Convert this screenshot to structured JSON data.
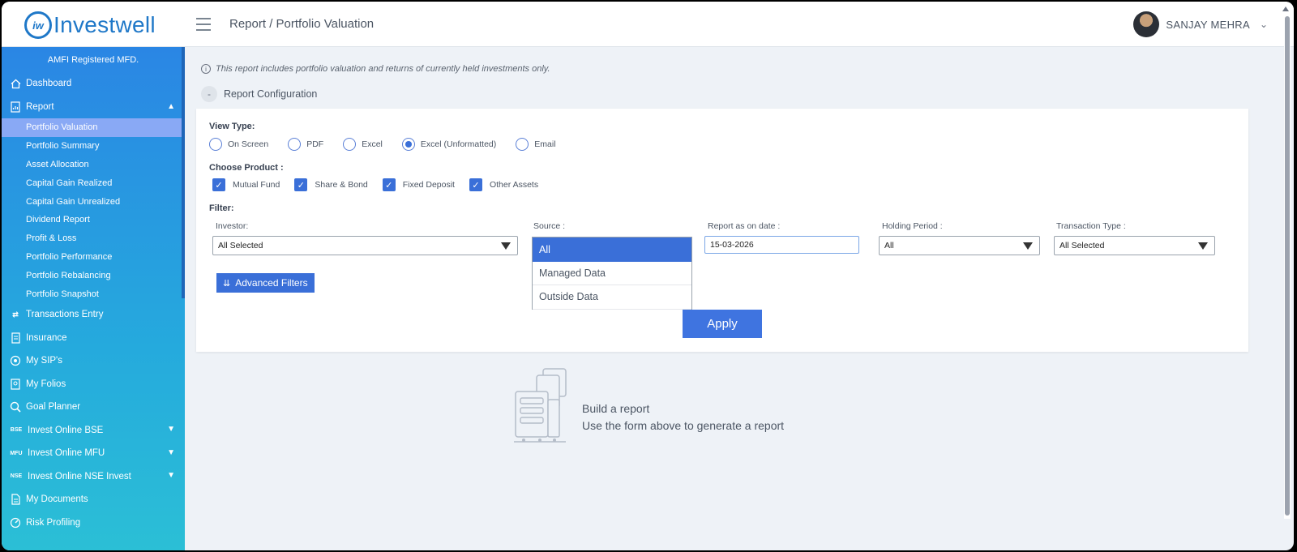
{
  "header": {
    "logo_text": "Investwell",
    "logo_mark": "iw",
    "breadcrumb": "Report / Portfolio Valuation",
    "user_name": "SANJAY MEHRA"
  },
  "sidebar": {
    "amfi": "AMFI Registered MFD.",
    "items": [
      {
        "label": "Dashboard",
        "icon": "home-icon"
      },
      {
        "label": "Report",
        "icon": "report-icon",
        "expanded": true
      },
      {
        "label": "Transactions Entry",
        "icon": "transfer-icon"
      },
      {
        "label": "Insurance",
        "icon": "insurance-icon"
      },
      {
        "label": "My SIP's",
        "icon": "sip-icon"
      },
      {
        "label": "My Folios",
        "icon": "folios-icon"
      },
      {
        "label": "Goal Planner",
        "icon": "goal-icon"
      },
      {
        "label": "Invest Online BSE",
        "icon_text": "BSE"
      },
      {
        "label": "Invest Online MFU",
        "icon_text": "MFU"
      },
      {
        "label": "Invest Online NSE Invest",
        "icon_text": "NSE"
      },
      {
        "label": "My Documents",
        "icon": "document-icon"
      },
      {
        "label": "Risk Profiling",
        "icon": "gauge-icon"
      }
    ],
    "report_sub": [
      "Portfolio Valuation",
      "Portfolio Summary",
      "Asset Allocation",
      "Capital Gain Realized",
      "Capital Gain Unrealized",
      "Dividend Report",
      "Profit & Loss",
      "Portfolio Performance",
      "Portfolio Rebalancing",
      "Portfolio Snapshot"
    ],
    "active_sub": "Portfolio Valuation"
  },
  "main": {
    "info": "This report includes portfolio valuation and returns of currently held investments only.",
    "config_toggle": "-",
    "config_label": "Report Configuration",
    "view_type_label": "View Type:",
    "view_types": [
      "On Screen",
      "PDF",
      "Excel",
      "Excel (Unformatted)",
      "Email"
    ],
    "view_type_selected": "Excel (Unformatted)",
    "product_label": "Choose Product :",
    "products": [
      "Mutual Fund",
      "Share & Bond",
      "Fixed Deposit",
      "Other Assets"
    ],
    "filter_label": "Filter:",
    "investor_label": "Investor:",
    "investor_value": "All Selected",
    "source_label": "Source :",
    "source_options": [
      "All",
      "Managed Data",
      "Outside Data"
    ],
    "source_selected": "All",
    "date_label": "Report as on date :",
    "date_value": "15-03-2026",
    "holding_label": "Holding Period :",
    "holding_value": "All",
    "txn_label": "Transaction Type :",
    "txn_value": "All Selected",
    "advanced_filters": "Advanced Filters",
    "apply": "Apply",
    "empty_title": "Build a report",
    "empty_sub": "Use the form above to generate a report"
  },
  "colors": {
    "primary": "#3a6fd8",
    "sidebar_top": "#2a86e4",
    "sidebar_bottom": "#2bbfd6",
    "brand": "#1f78c8"
  }
}
